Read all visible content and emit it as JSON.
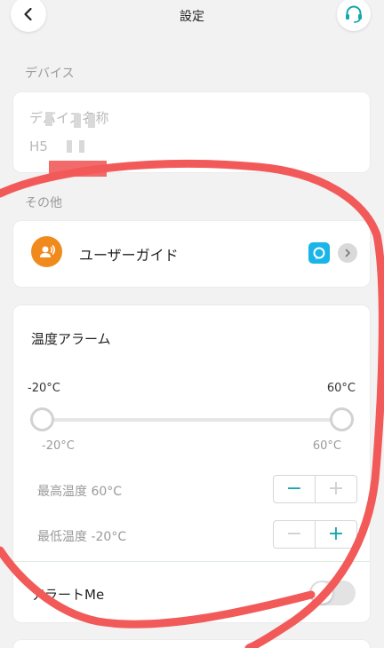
{
  "header": {
    "title": "設定",
    "back_icon": "chevron-left-icon",
    "support_icon": "headset-icon"
  },
  "device_section": {
    "label": "デバイス",
    "name_label": "デバイス名称",
    "name_value": "H5"
  },
  "other_section": {
    "label": "その他",
    "guide": {
      "label": "ユーザーガイド",
      "icon": "user-voice-icon",
      "alexa_icon": "alexa-icon",
      "chevron_icon": "chevron-right-icon"
    }
  },
  "temperature_alarm": {
    "title": "温度アラーム",
    "range_min": "-20°C",
    "range_max": "60°C",
    "slider_min_label": "-20°C",
    "slider_max_label": "60°C",
    "high_label": "最高温度 60°C",
    "low_label": "最低温度 -20°C",
    "minus_symbol": "−",
    "plus_symbol": "+",
    "alert_label": "アラートMe",
    "alert_enabled": false
  },
  "colors": {
    "accent": "#12a7ad",
    "guide_icon_bg": "#f08a1c",
    "alexa_bg": "#19b4e8",
    "annotation_stroke": "#f25a5a"
  }
}
